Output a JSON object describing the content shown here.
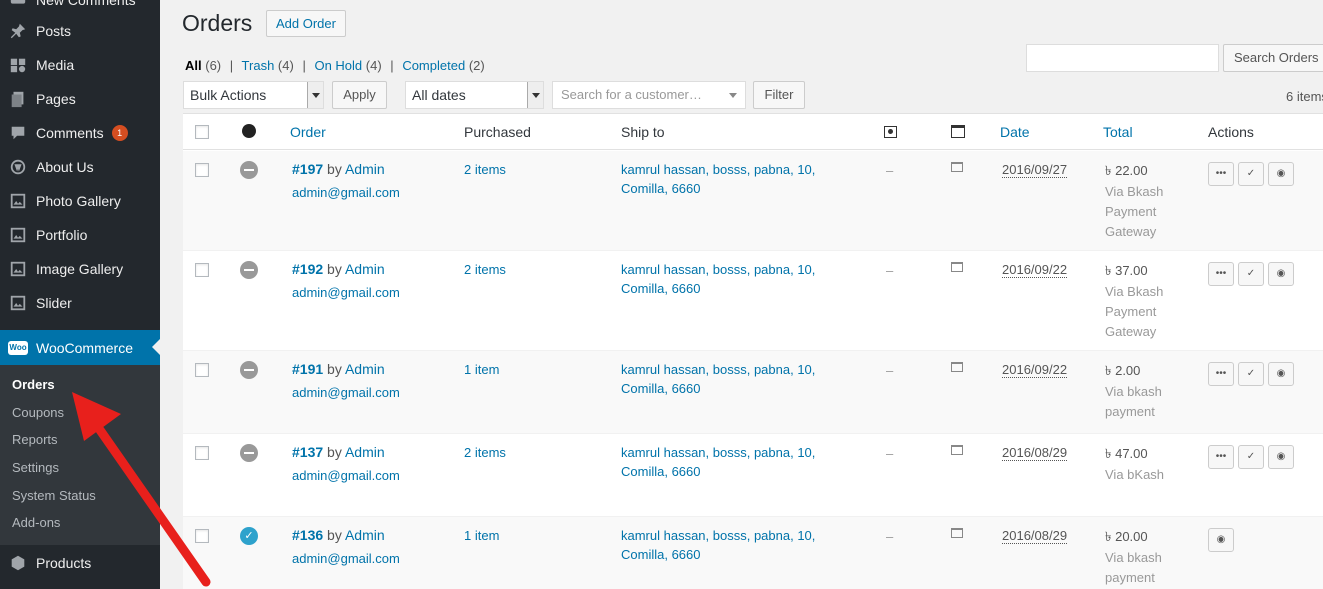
{
  "sidebar": {
    "partial_top": "New Comments",
    "items": [
      {
        "label": "Posts",
        "icon": "pin-icon"
      },
      {
        "label": "Media",
        "icon": "media-icon"
      },
      {
        "label": "Pages",
        "icon": "pages-icon"
      },
      {
        "label": "Comments",
        "icon": "comments-icon",
        "badge": "1"
      },
      {
        "label": "About Us",
        "icon": "wordpress-icon"
      },
      {
        "label": "Photo Gallery",
        "icon": "gallery-icon"
      },
      {
        "label": "Portfolio",
        "icon": "gallery-icon"
      },
      {
        "label": "Image Gallery",
        "icon": "gallery-icon"
      },
      {
        "label": "Slider",
        "icon": "gallery-icon"
      }
    ],
    "woocommerce": {
      "logo": "Woo",
      "label": "WooCommerce"
    },
    "submenu": [
      "Orders",
      "Coupons",
      "Reports",
      "Settings",
      "System Status",
      "Add-ons"
    ],
    "products": "Products"
  },
  "header": {
    "title": "Orders",
    "add_order": "Add Order"
  },
  "filters": {
    "all": "All",
    "all_count": "(6)",
    "trash": "Trash",
    "trash_count": "(4)",
    "on_hold": "On Hold",
    "on_hold_count": "(4)",
    "completed": "Completed",
    "completed_count": "(2)",
    "separator": "|"
  },
  "search": {
    "button": "Search Orders",
    "value": ""
  },
  "toolbar": {
    "bulk_actions": "Bulk Actions",
    "apply": "Apply",
    "dates": "All dates",
    "customer_placeholder": "Search for a customer…",
    "filter": "Filter",
    "items_count": "6 items"
  },
  "columns": {
    "order": "Order",
    "purchased": "Purchased",
    "ship_to": "Ship to",
    "date": "Date",
    "total": "Total",
    "actions": "Actions"
  },
  "orders": [
    {
      "num": "#197",
      "by": "by",
      "customer": "Admin",
      "email": "admin@gmail.com",
      "purchased": "2 items",
      "ship1": "kamrul hassan, bosss, pabna, 10,",
      "ship2": "Comilla, 6660",
      "dash": "–",
      "date": "2016/09/27",
      "total": "৳ 22.00",
      "via": "Via Bkash Payment Gateway",
      "status": "on-hold"
    },
    {
      "num": "#192",
      "by": "by",
      "customer": "Admin",
      "email": "admin@gmail.com",
      "purchased": "2 items",
      "ship1": "kamrul hassan, bosss, pabna, 10,",
      "ship2": "Comilla, 6660",
      "dash": "–",
      "date": "2016/09/22",
      "total": "৳ 37.00",
      "via": "Via Bkash Payment Gateway",
      "status": "on-hold"
    },
    {
      "num": "#191",
      "by": "by",
      "customer": "Admin",
      "email": "admin@gmail.com",
      "purchased": "1 item",
      "ship1": "kamrul hassan, bosss, pabna, 10,",
      "ship2": "Comilla, 6660",
      "dash": "–",
      "date": "2016/09/22",
      "total": "৳ 2.00",
      "via": "Via bkash payment",
      "status": "on-hold"
    },
    {
      "num": "#137",
      "by": "by",
      "customer": "Admin",
      "email": "admin@gmail.com",
      "purchased": "2 items",
      "ship1": "kamrul hassan, bosss, pabna, 10,",
      "ship2": "Comilla, 6660",
      "dash": "–",
      "date": "2016/08/29",
      "total": "৳ 47.00",
      "via": "Via bKash",
      "status": "on-hold"
    },
    {
      "num": "#136",
      "by": "by",
      "customer": "Admin",
      "email": "admin@gmail.com",
      "purchased": "1 item",
      "ship1": "kamrul hassan, bosss, pabna, 10,",
      "ship2": "Comilla, 6660",
      "dash": "–",
      "date": "2016/08/29",
      "total": "৳ 20.00",
      "via": "Via bkash payment",
      "status": "completed"
    }
  ],
  "action_glyphs": {
    "processing": "•••",
    "complete": "✓",
    "view": "◉",
    "done_check": "✓"
  },
  "colors": {
    "accent": "#0073aa",
    "sidebar": "#23282d",
    "arrow": "#e8201c"
  }
}
